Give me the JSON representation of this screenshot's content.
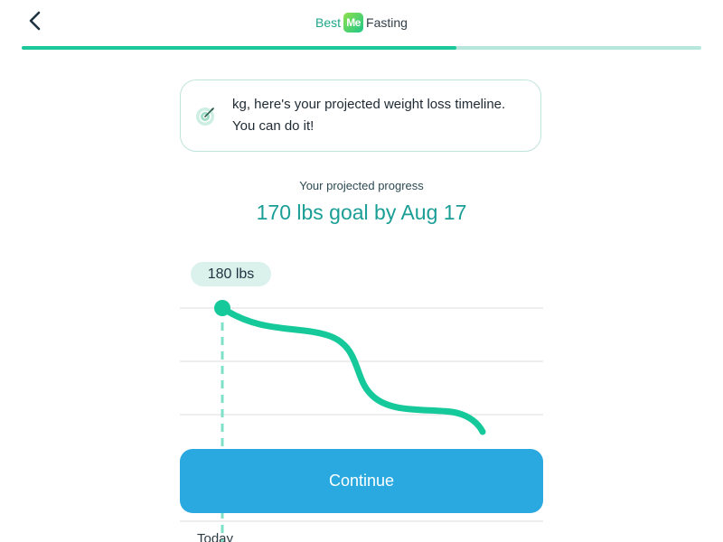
{
  "header": {
    "back_icon": "chevron-left-icon",
    "brand_left": "Best",
    "brand_logo": "Me",
    "brand_right": "Fasting"
  },
  "progress": {
    "fraction": 0.64,
    "fill_color": "#1cc79a",
    "track_color": "#b6e6dd"
  },
  "message": {
    "icon": "target-icon",
    "text": "kg, here's your projected weight loss timeline. You can do it!"
  },
  "projection": {
    "subtitle": "Your projected progress",
    "goal": "170 lbs goal by Aug 17"
  },
  "chart": {
    "start_label": "180 lbs",
    "today_label": "Today",
    "curve_color": "#16c99a",
    "marker_line_color": "#7fe0c8"
  },
  "actions": {
    "continue_label": "Continue",
    "continue_color": "#2aa9e0"
  }
}
